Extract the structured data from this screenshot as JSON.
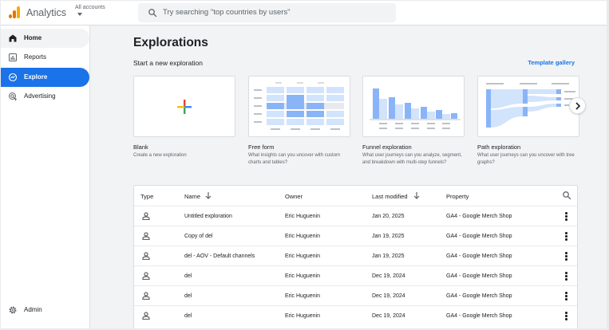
{
  "header": {
    "app_name": "Analytics",
    "account_label": "All accounts",
    "search_placeholder": "Try searching \"top countries by users\""
  },
  "sidebar": {
    "items": [
      {
        "label": "Home",
        "icon": "home-icon",
        "state": "hover"
      },
      {
        "label": "Reports",
        "icon": "bar-chart-icon"
      },
      {
        "label": "Explore",
        "icon": "explore-icon",
        "state": "active"
      },
      {
        "label": "Advertising",
        "icon": "advertising-icon"
      }
    ],
    "admin_label": "Admin"
  },
  "main": {
    "title": "Explorations",
    "start_label": "Start a new exploration",
    "template_gallery": "Template gallery",
    "templates": [
      {
        "name": "Blank",
        "desc": "Create a new exploration"
      },
      {
        "name": "Free form",
        "desc": "What insights can you uncover with custom charts and tables?"
      },
      {
        "name": "Funnel exploration",
        "desc": "What user journeys can you analyze, segment, and breakdown with multi-step funnels?"
      },
      {
        "name": "Path exploration",
        "desc": "What user journeys can you uncover with tree graphs?"
      }
    ],
    "table": {
      "headers": {
        "type": "Type",
        "name": "Name",
        "owner": "Owner",
        "modified": "Last modified",
        "property": "Property"
      },
      "rows": [
        {
          "name": "Untitled exploration",
          "owner": "Eric Huguenin",
          "modified": "Jan 20, 2025",
          "property": "GA4 - Google Merch Shop"
        },
        {
          "name": "Copy of del",
          "owner": "Eric Huguenin",
          "modified": "Jan 19, 2025",
          "property": "GA4 - Google Merch Shop"
        },
        {
          "name": "del - AOV - Default channels",
          "owner": "Eric Huguenin",
          "modified": "Jan 19, 2025",
          "property": "GA4 - Google Merch Shop"
        },
        {
          "name": "del",
          "owner": "Eric Huguenin",
          "modified": "Dec 19, 2024",
          "property": "GA4 - Google Merch Shop"
        },
        {
          "name": "del",
          "owner": "Eric Huguenin",
          "modified": "Dec 19, 2024",
          "property": "GA4 - Google Merch Shop"
        },
        {
          "name": "del",
          "owner": "Eric Huguenin",
          "modified": "Dec 19, 2024",
          "property": "GA4 - Google Merch Shop"
        }
      ]
    }
  },
  "colors": {
    "accent": "#1a73e8",
    "logo_orange": "#e37400",
    "logo_yellow": "#f9ab00",
    "thumb_blue": "#8ab4f8",
    "thumb_light": "#d2e3fc"
  }
}
